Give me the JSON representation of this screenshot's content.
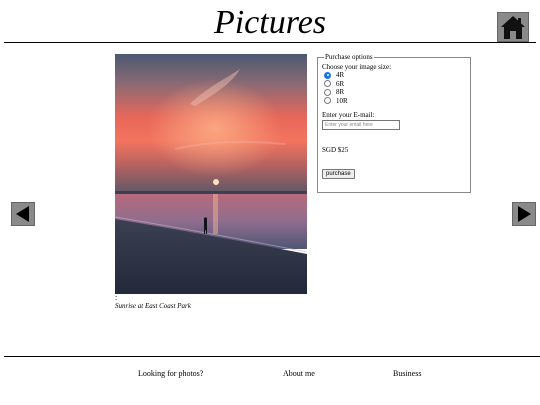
{
  "header": {
    "title": "Pictures",
    "home_icon": "home-icon"
  },
  "photo": {
    "caption": "Sunrise at East Coast Park",
    "dots": ":"
  },
  "purchase": {
    "legend": "Purchase options",
    "size_label": "Choose your image size:",
    "sizes": [
      {
        "label": "4R",
        "checked": true
      },
      {
        "label": "6R",
        "checked": false
      },
      {
        "label": "8R",
        "checked": false
      },
      {
        "label": "10R",
        "checked": false
      }
    ],
    "email_label": "Enter your E-mail:",
    "email_placeholder": "Enter your email here",
    "price": "SGD $25",
    "button_label": "purchase"
  },
  "nav": {
    "prev_icon": "left-arrow-icon",
    "next_icon": "right-arrow-icon"
  },
  "footer": {
    "links": [
      "Looking for photos?",
      "About me",
      "Business"
    ]
  },
  "colors": {
    "icon_bg": "#8a8a8a",
    "radio_accent": "#1a73e8"
  }
}
